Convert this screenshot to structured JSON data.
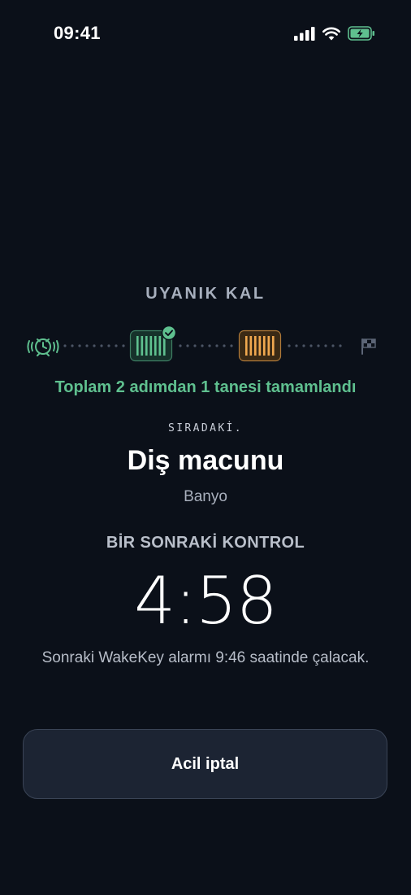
{
  "status_bar": {
    "time": "09:41",
    "icons": [
      "cellular-signal-icon",
      "wifi-icon",
      "battery-charging-icon"
    ]
  },
  "section_title": "UYANIK KAL",
  "progress": {
    "completed_steps": 1,
    "total_steps": 2,
    "text": "Toplam 2 adımdan 1 tanesi tamamlandı",
    "steps": [
      {
        "icon": "alarm-clock-icon",
        "state": "start"
      },
      {
        "icon": "barcode-icon",
        "state": "done"
      },
      {
        "icon": "barcode-icon",
        "state": "current"
      },
      {
        "icon": "finish-flag-icon",
        "state": "end"
      }
    ]
  },
  "next": {
    "label": "SIRADAKİ.",
    "task": "Diş macunu",
    "location": "Banyo"
  },
  "check": {
    "label": "BİR SONRAKİ KONTROL",
    "countdown": "4:58"
  },
  "next_alarm_text": "Sonraki WakeKey alarmı 9:46 saatinde çalacak.",
  "actions": {
    "cancel_label": "Acil iptal"
  },
  "colors": {
    "background": "#0b1019",
    "done_green": "#5fc08f",
    "current_orange": "#f0a84f",
    "button_bg": "#1c2433"
  }
}
